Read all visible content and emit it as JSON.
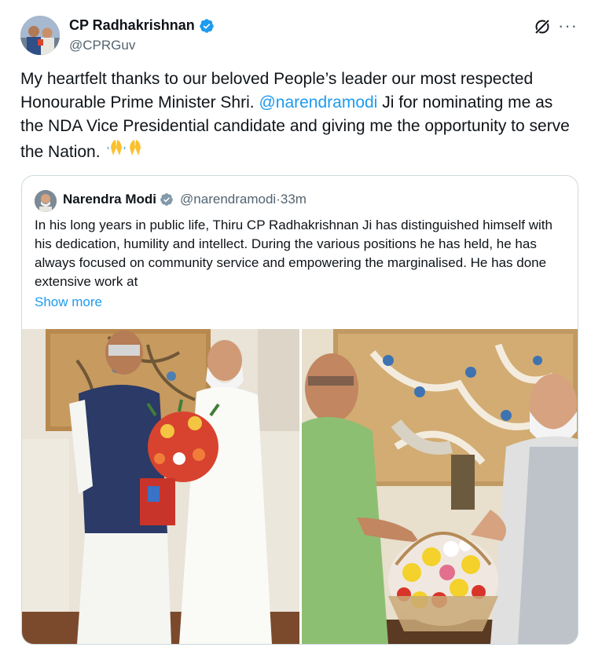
{
  "author": {
    "name": "CP Radhakrishnan",
    "handle": "@CPRGuv"
  },
  "tweet": {
    "text_before": "My heartfelt thanks to our beloved People’s leader our most respected Honourable Prime Minister Shri. ",
    "mention": "@narendramodi",
    "text_after": " Ji for nominating me as the NDA Vice Presidential candidate and giving me the opportunity to serve the Nation.",
    "emoji": "🙏🙏"
  },
  "quote": {
    "name": "Narendra Modi",
    "handle": "@narendramodi",
    "separator": " · ",
    "time": "33m",
    "text": "In his long years in public life, Thiru CP Radhakrishnan Ji has distinguished himself with his dedication, humility and intellect. During the various positions he has held, he has always focused on community service and empowering the marginalised. He has done extensive work at",
    "show_more": "Show more"
  },
  "icons": {
    "verified": "verified-badge-icon",
    "grok": "grok-icon",
    "more": "more-options-icon"
  },
  "colors": {
    "link": "#1d9bf0",
    "secondary_text": "#536471",
    "border": "#cfd9de"
  }
}
